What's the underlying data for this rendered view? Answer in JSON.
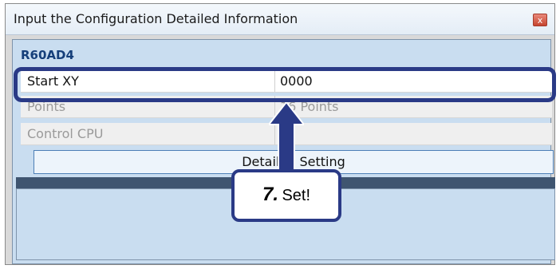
{
  "window": {
    "title": "Input the Configuration Detailed Information",
    "close_label": "x"
  },
  "section": {
    "header": "R60AD4"
  },
  "rows": [
    {
      "label": "Start XY",
      "value": "0000"
    },
    {
      "label": "Points",
      "value": "16 Points"
    },
    {
      "label": "Control CPU",
      "value": ""
    }
  ],
  "detail_button": {
    "label": "Detailed Setting"
  },
  "callout": {
    "number": "7.",
    "text": "Set!"
  },
  "colors": {
    "accent": "#2a3a86",
    "panel": "#c9ddf0",
    "dark_bar": "#3f5570"
  }
}
